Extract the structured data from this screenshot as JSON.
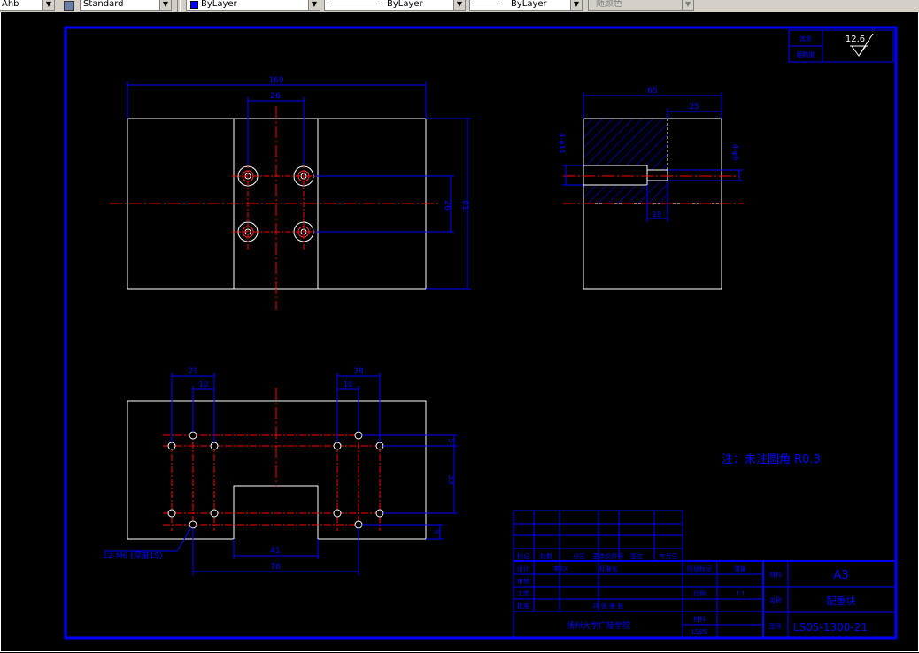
{
  "toolbar": {
    "textstyle_value": "Ahb",
    "dimstyle_value": "Standard",
    "layer_color_value": "ByLayer",
    "linetype_value": "ByLayer",
    "lineweight_value": "ByLayer",
    "plotstyle_value": "随颜色"
  },
  "roughness": {
    "label1": "其余",
    "label2": "粗糙度",
    "value": "12.6"
  },
  "front_view": {
    "width": "160",
    "hole_spacing": "26",
    "vertical_spacing": "26",
    "height": "81"
  },
  "side_view": {
    "depth": "65",
    "hatch_width": "25",
    "hole_label": "4-φ11",
    "thread_label": "4-φ6",
    "bore_depth": "18"
  },
  "bottom_view": {
    "dim_21": "21",
    "dim_10a": "10",
    "dim_28": "28",
    "dim_10b": "10",
    "dim_5a": "5",
    "dim_33": "33",
    "dim_5b": "5",
    "dim_41": "41",
    "dim_78": "78",
    "hole_callout": "12-M6 (深度15)"
  },
  "note": "注：未注圆角 R0.3",
  "title_block": {
    "rev_headers": [
      "标记",
      "处数",
      "分区",
      "更改文件号",
      "签名",
      "年月日"
    ],
    "design_label": "设计",
    "design_name": "李XX",
    "std_label": "标准化",
    "review_label": "审核",
    "process_label": "工艺",
    "approve_label": "批准",
    "stage_label": "阶段标记",
    "weight_label": "重量",
    "scale_label": "比例",
    "material_label": "材料",
    "paper_size": "A3",
    "name_label": "名称",
    "part_name": "配重块",
    "drawing_no_label": "图号",
    "drawing_no": "LS05-1300-21",
    "school": "扬州大学广陵学院",
    "sheet_label": "共 张 第 张",
    "scale_value": "1:1",
    "small_code": "LS05"
  }
}
